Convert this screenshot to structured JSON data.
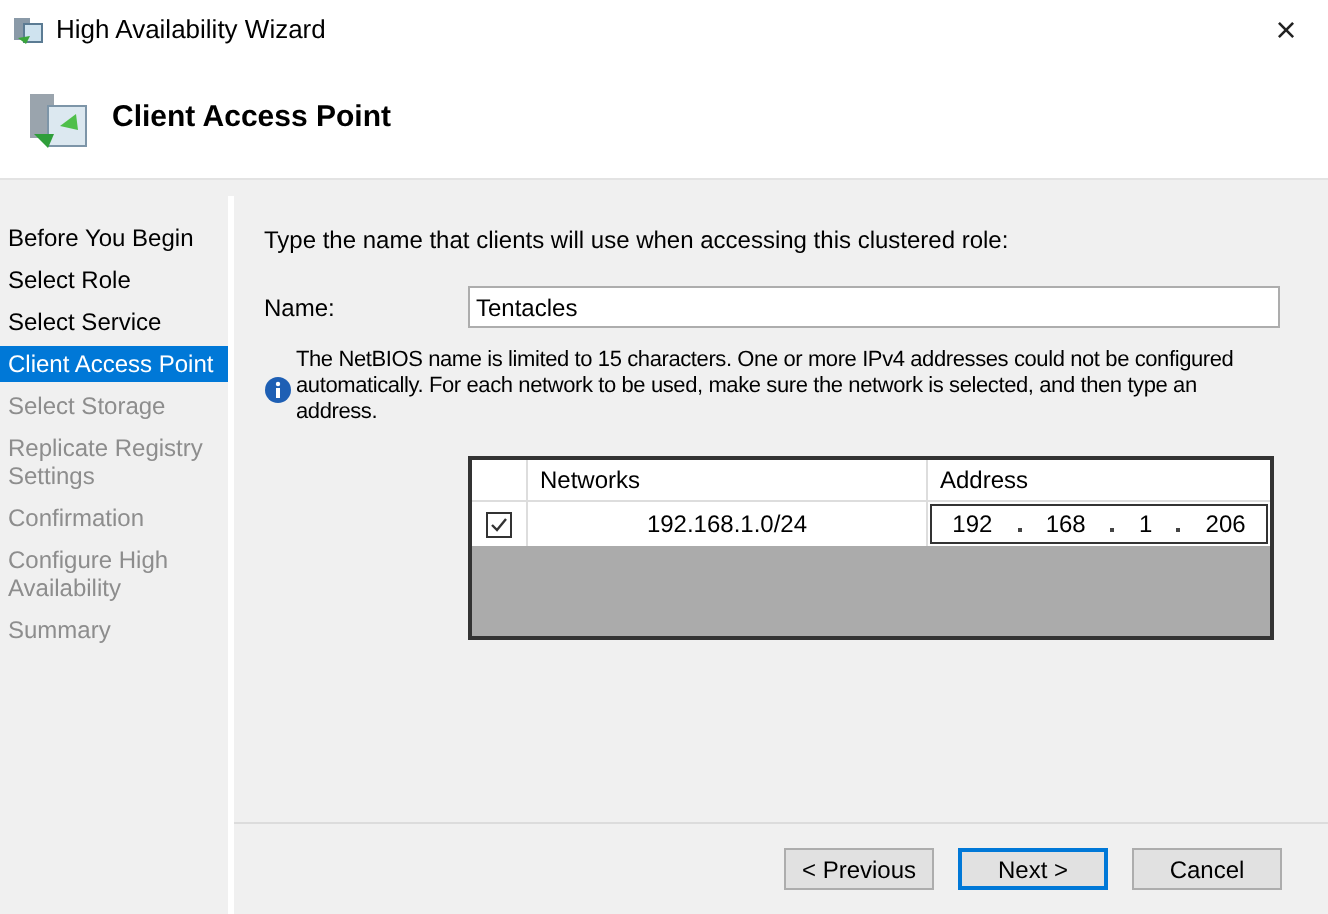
{
  "window": {
    "title": "High Availability Wizard",
    "close": "×"
  },
  "header": {
    "title": "Client Access Point"
  },
  "steps": [
    {
      "label": "Before You Begin",
      "selected": false,
      "disabled": false
    },
    {
      "label": "Select Role",
      "selected": false,
      "disabled": false
    },
    {
      "label": "Select Service",
      "selected": false,
      "disabled": false
    },
    {
      "label": "Client Access Point",
      "selected": true,
      "disabled": false
    },
    {
      "label": "Select Storage",
      "selected": false,
      "disabled": true
    },
    {
      "label": "Replicate Registry Settings",
      "selected": false,
      "disabled": true
    },
    {
      "label": "Confirmation",
      "selected": false,
      "disabled": true
    },
    {
      "label": "Configure High Availability",
      "selected": false,
      "disabled": true
    },
    {
      "label": "Summary",
      "selected": false,
      "disabled": true
    }
  ],
  "instruction": "Type the name that clients will use when accessing this clustered role:",
  "name_field": {
    "label": "Name:",
    "value": "Tentacles"
  },
  "info": "The NetBIOS name is limited to 15 characters.  One or more IPv4 addresses could not be configured automatically.  For each network to be used, make sure the network is selected, and then type an address.",
  "table": {
    "columns": [
      "Networks",
      "Address"
    ],
    "rows": [
      {
        "checked": true,
        "network": "192.168.1.0/24",
        "address": [
          "192",
          "168",
          "1",
          "206"
        ]
      }
    ]
  },
  "buttons": [
    {
      "label": "< Previous",
      "default": false
    },
    {
      "label": "Next >",
      "default": true
    },
    {
      "label": "Cancel",
      "default": false
    }
  ]
}
